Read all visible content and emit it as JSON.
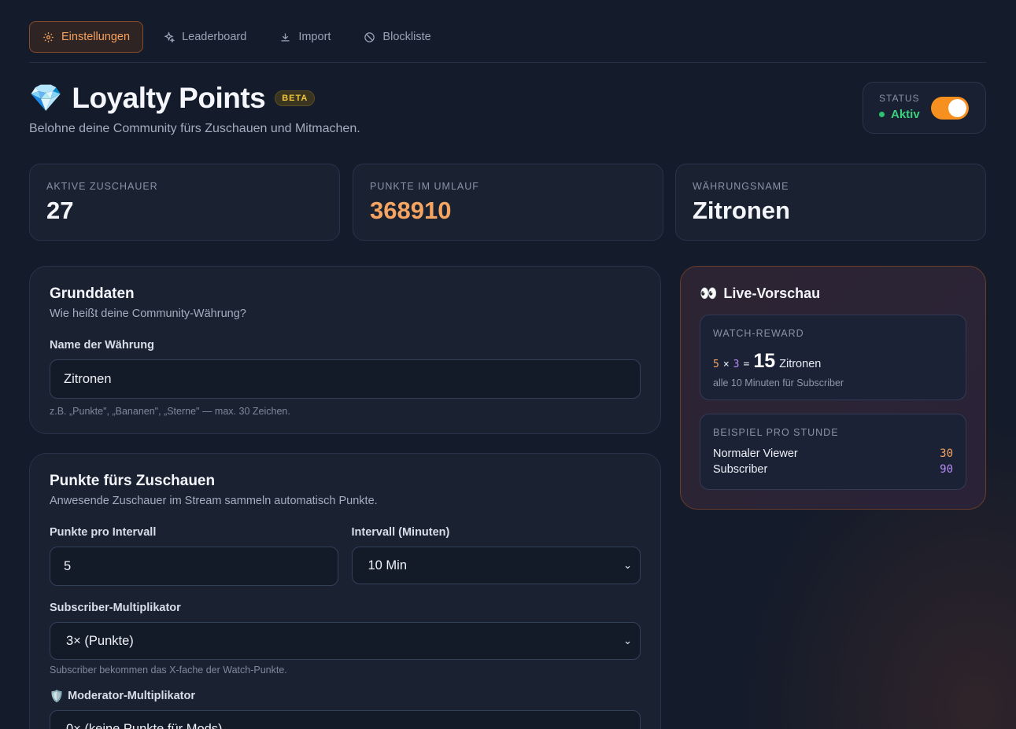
{
  "tabs": [
    {
      "label": "Einstellungen",
      "icon": "gear-icon",
      "active": true
    },
    {
      "label": "Leaderboard",
      "icon": "sparkles-icon",
      "active": false
    },
    {
      "label": "Import",
      "icon": "download-icon",
      "active": false
    },
    {
      "label": "Blockliste",
      "icon": "ban-icon",
      "active": false
    }
  ],
  "header": {
    "emoji": "💎",
    "title": "Loyalty Points",
    "badge": "BETA",
    "subtitle": "Belohne deine Community fürs Zuschauen und Mitmachen."
  },
  "status": {
    "label": "STATUS",
    "value": "Aktiv",
    "enabled": true
  },
  "stats": [
    {
      "label": "AKTIVE ZUSCHAUER",
      "value": "27"
    },
    {
      "label": "PUNKTE IM UMLAUF",
      "value": "368910"
    },
    {
      "label": "WÄHRUNGSNAME",
      "value": "Zitronen"
    }
  ],
  "grunddaten": {
    "title": "Grunddaten",
    "desc": "Wie heißt deine Community-Währung?",
    "field_label": "Name der Währung",
    "field_value": "Zitronen",
    "hint": "z.B. „Punkte\", „Bananen\", „Sterne\" — max. 30 Zeichen."
  },
  "watch": {
    "title": "Punkte fürs Zuschauen",
    "desc": "Anwesende Zuschauer im Stream sammeln automatisch Punkte.",
    "points_label": "Punkte pro Intervall",
    "points_value": "5",
    "interval_label": "Intervall (Minuten)",
    "interval_value": "10 Min",
    "sub_label": "Subscriber-Multiplikator",
    "sub_value": "3× (Punkte)",
    "sub_hint": "Subscriber bekommen das X-fache der Watch-Punkte.",
    "mod_label": "Moderator-Multiplikator",
    "mod_emoji": "🛡️",
    "mod_value": "0× (keine Punkte für Mods)"
  },
  "preview": {
    "emoji": "👀",
    "title": "Live-Vorschau",
    "reward_label": "WATCH-REWARD",
    "calc_a": "5",
    "calc_x": "×",
    "calc_b": "3",
    "calc_eq": "=",
    "calc_result": "15",
    "calc_unit": "Zitronen",
    "reward_note": "alle 10 Minuten für Subscriber",
    "hour_label": "BEISPIEL PRO STUNDE",
    "rows": [
      {
        "label": "Normaler Viewer",
        "value": "30"
      },
      {
        "label": "Subscriber",
        "value": "90"
      }
    ]
  }
}
